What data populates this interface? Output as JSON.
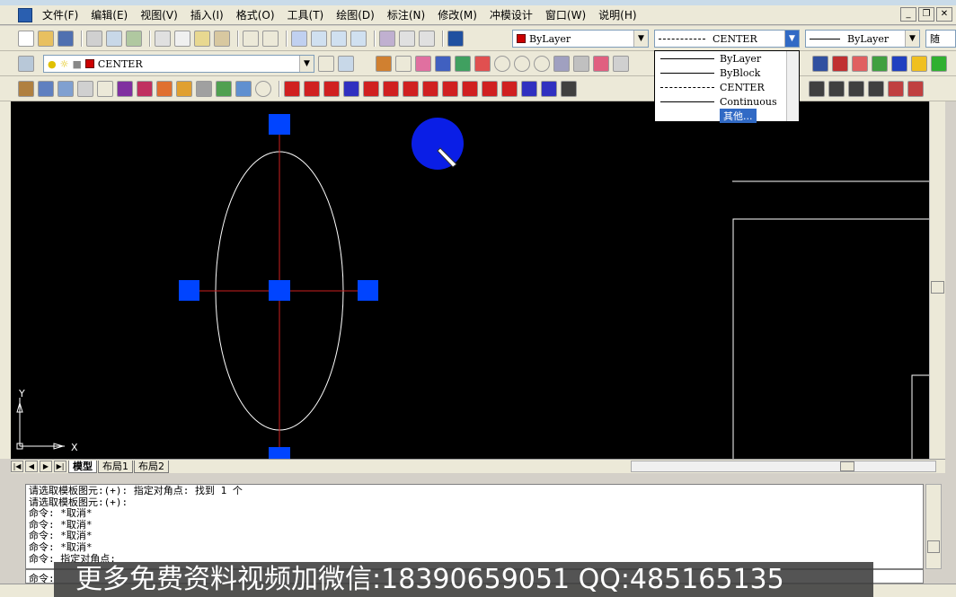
{
  "menu": {
    "items": [
      "文件(F)",
      "编辑(E)",
      "视图(V)",
      "插入(I)",
      "格式(O)",
      "工具(T)",
      "绘图(D)",
      "标注(N)",
      "修改(M)",
      "冲模设计",
      "窗口(W)",
      "说明(H)"
    ]
  },
  "toolbar": {
    "color_select": "ByLayer",
    "linetype_select": "CENTER",
    "lineweight_select": "ByLayer",
    "plotstyle_select": "随",
    "layer_select": "CENTER"
  },
  "linetype_dropdown": {
    "options": [
      "ByLayer",
      "ByBlock",
      "CENTER",
      "Continuous",
      "其他..."
    ],
    "selected_index": 4
  },
  "drawing": {
    "axis_x_label": "X",
    "axis_y_label": "Y"
  },
  "tabs": {
    "model": "模型",
    "layout1": "布局1",
    "layout2": "布局2"
  },
  "command": {
    "history": [
      "请选取模板图元:(+): 指定对角点: 找到 1 个",
      "请选取模板图元:(+):",
      "命令: *取消*",
      "命令: *取消*",
      "命令: *取消*",
      "命令: *取消*",
      "命令: 指定对角点:"
    ],
    "prompt": "命令:"
  },
  "watermark": {
    "text": "更多免费资料视频加微信:18390659051 QQ:485165135"
  },
  "colors": {
    "drawing_bg": "#000000",
    "grip": "#0044ff",
    "centerline": "#cc2020",
    "geometry": "#ffffff"
  }
}
